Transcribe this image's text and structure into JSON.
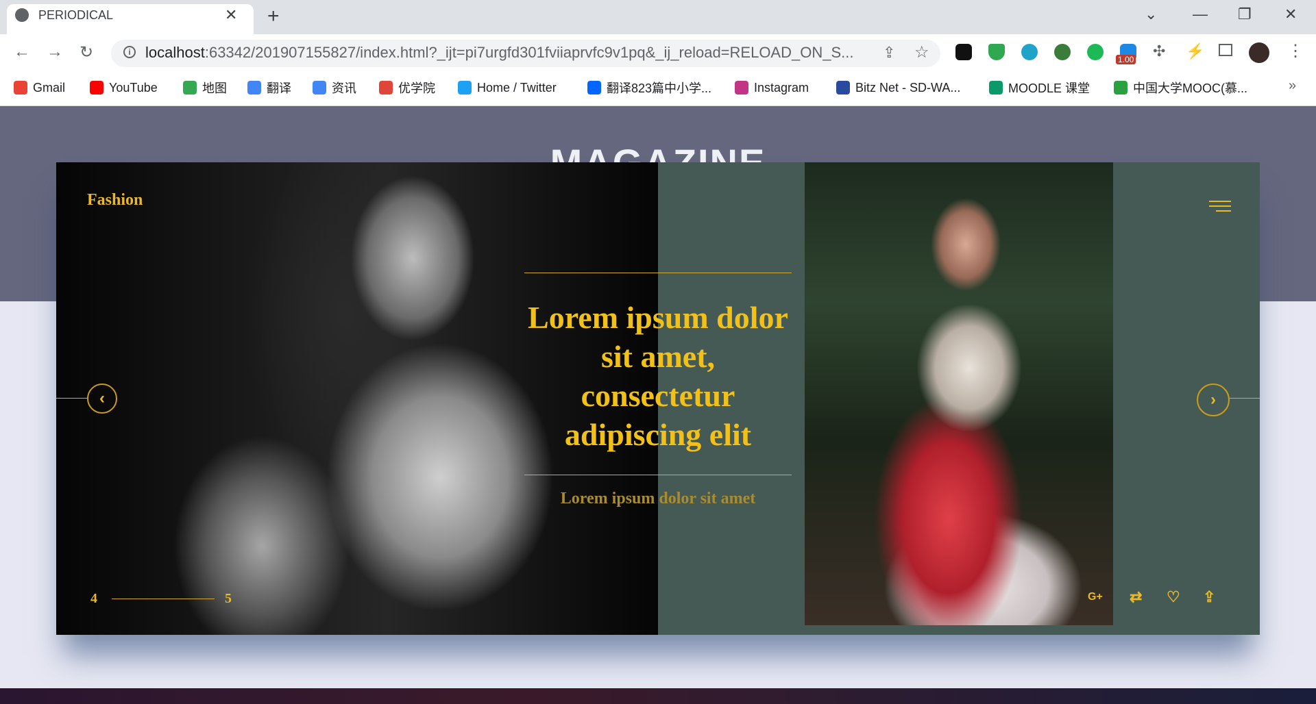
{
  "browser": {
    "tab_title": "PERIODICAL",
    "new_tab_label": "+",
    "url_host": "localhost",
    "url_rest": ":63342/201907155827/index.html?_ijt=pi7urgfd301fviiaprvfc9v1pq&_ij_reload=RELOAD_ON_S...",
    "extension_badge": "1.00",
    "bookmarks": [
      {
        "label": "Gmail",
        "icon": "gmail-icon",
        "color": "#ea4335"
      },
      {
        "label": "YouTube",
        "icon": "youtube-icon",
        "color": "#ff0000"
      },
      {
        "label": "地图",
        "icon": "maps-icon",
        "color": "#34a853"
      },
      {
        "label": "翻译",
        "icon": "translate-icon",
        "color": "#4285f4"
      },
      {
        "label": "资讯",
        "icon": "news-icon",
        "color": "#4285f4"
      },
      {
        "label": "优学院",
        "icon": "ulearning-icon",
        "color": "#e0453a"
      },
      {
        "label": "Home / Twitter",
        "icon": "twitter-icon",
        "color": "#1da1f2"
      },
      {
        "label": "翻译823篇中小学...",
        "icon": "zhihu-icon",
        "color": "#0066ff"
      },
      {
        "label": "Instagram",
        "icon": "instagram-icon",
        "color": "#c13584"
      },
      {
        "label": "Bitz Net - SD-WA...",
        "icon": "bitz-icon",
        "color": "#2a4aa0"
      },
      {
        "label": "MOODLE 课堂",
        "icon": "moodle-icon",
        "color": "#0a9a6a"
      },
      {
        "label": "中国大学MOOC(慕...",
        "icon": "mooc-icon",
        "color": "#2aa040"
      }
    ],
    "bookmarks_more": "»"
  },
  "page": {
    "background_title": "MAGAZINE",
    "slider": {
      "brand": "Fashion",
      "headline": "Lorem ipsum dolor sit amet, consectetur adipiscing elit",
      "subtitle": "Lorem ipsum dolor sit amet",
      "counter_current": "4",
      "counter_total": "5",
      "prev_icon": "chevron-left-icon",
      "next_icon": "chevron-right-icon",
      "actions": [
        "google-plus-icon",
        "repost-icon",
        "heart-icon",
        "share-icon"
      ],
      "accent_color": "#e9b92a",
      "panel_color": "#465a55"
    }
  }
}
